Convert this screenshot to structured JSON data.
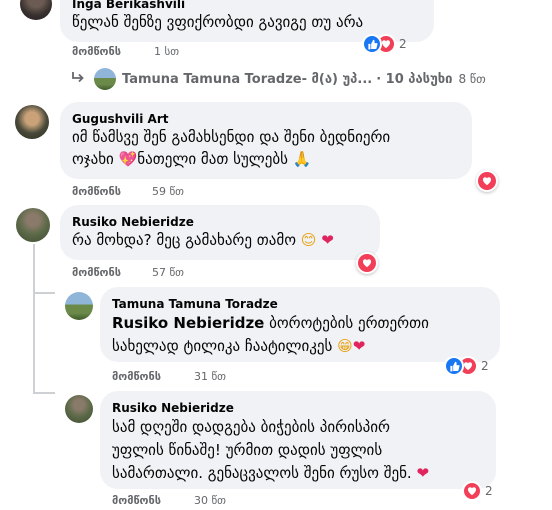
{
  "comments": [
    {
      "author": "Inga Berikashvili",
      "text_lines": [
        "წელან შენზე ვფიქრობდი გავიგე თუ არა"
      ],
      "like_label": "მომწონს",
      "time": "1 სთ",
      "reaction_count": "2",
      "reactions": [
        "like-icon",
        "love-icon"
      ]
    },
    {
      "reply_summary": {
        "author": "Tamuna Tamuna Toradze",
        "label": "Tamuna Tamuna Toradze- მ(ა) უპ...",
        "count_label": "· 10 პასუხი",
        "time": "8 წთ"
      }
    },
    {
      "author": "Gugushvili Art",
      "text_lines": [
        "იმ წამსვე შენ გამახსენდი და შენი ბედნიერი",
        "ოჯახი ",
        "ნათელი მათ სულებს "
      ],
      "emojis": [
        "💖",
        "🙏"
      ],
      "like_label": "მომწონს",
      "time": "59 წთ",
      "reactions": [
        "love-icon"
      ]
    },
    {
      "author": "Rusiko Nebieridze",
      "text_lines": [
        "რა მოხდა? მეც გამახარე თამო "
      ],
      "emojis": [
        "😊",
        "❤"
      ],
      "like_label": "მომწონს",
      "time": "57 წთ",
      "reactions": [
        "love-icon"
      ]
    },
    {
      "author": "Tamuna Tamuna Toradze",
      "mention": "Rusiko Nebieridze",
      "text_lines": [
        " ბოროტების ერთერთი",
        "სახელად ტილიკა ჩაატილიკეს "
      ],
      "emojis": [
        "😁",
        "❤"
      ],
      "like_label": "მომწონს",
      "time": "31 წთ",
      "reaction_count": "2",
      "reactions": [
        "like-icon",
        "love-icon"
      ]
    },
    {
      "author": "Rusiko Nebieridze",
      "text_lines": [
        "სამ დღეში დადგება ბიჭების პირისპირ",
        "უფლის წინაშე! ურმით დადის უფლის",
        "სამართალი. გენაცვალოს შენი რუსო შენ. "
      ],
      "emojis": [
        "❤"
      ],
      "like_label": "მომწონს",
      "time": "30 წთ",
      "reaction_count": "2",
      "reactions": [
        "love-icon"
      ]
    }
  ],
  "colors": {
    "bubble": "#f0f2f5",
    "secondary_text": "#65676b",
    "like_blue": "#1877f2",
    "love_red": "#f33e58"
  }
}
